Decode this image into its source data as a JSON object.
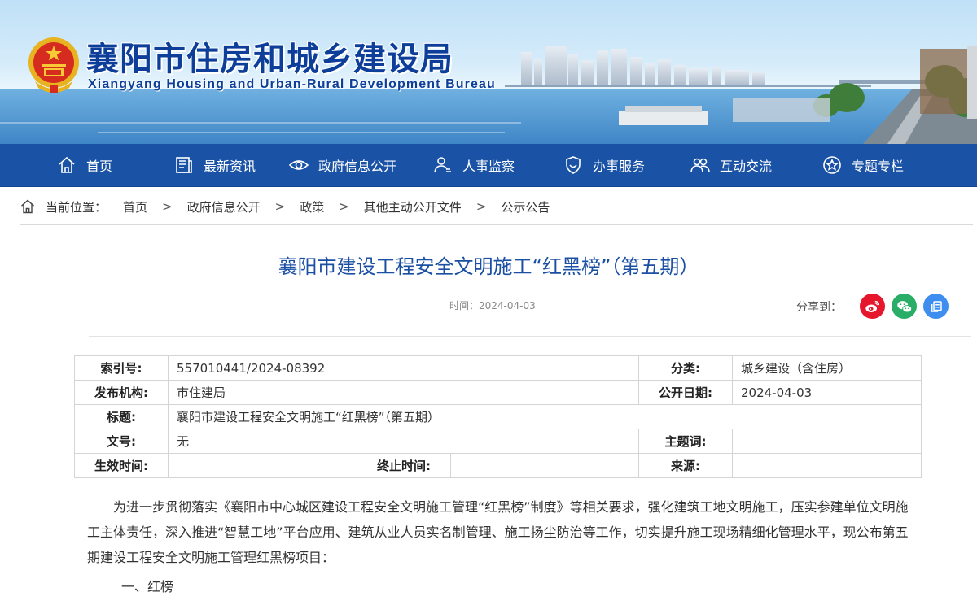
{
  "header": {
    "title": "襄阳市住房和城乡建设局",
    "subtitle": "Xiangyang Housing and Urban-Rural Development Bureau"
  },
  "nav": {
    "items": [
      {
        "label": "首页",
        "icon": "home-icon"
      },
      {
        "label": "最新资讯",
        "icon": "news-icon"
      },
      {
        "label": "政府信息公开",
        "icon": "eye-icon"
      },
      {
        "label": "人事监察",
        "icon": "person-icon"
      },
      {
        "label": "办事服务",
        "icon": "shield-icon"
      },
      {
        "label": "互动交流",
        "icon": "people-icon"
      },
      {
        "label": "专题专栏",
        "icon": "star-icon"
      }
    ]
  },
  "breadcrumb": {
    "prefix": "当前位置：",
    "separator": ">",
    "items": [
      "首页",
      "政府信息公开",
      "政策",
      "其他主动公开文件",
      "公示公告"
    ]
  },
  "article": {
    "title": "襄阳市建设工程安全文明施工“红黑榜”（第五期）",
    "time": "时间：2024-04-03",
    "share_label": "分享到：",
    "share_buttons": [
      {
        "name": "weibo",
        "color": "#e6162d"
      },
      {
        "name": "wechat",
        "color": "#2aae67"
      },
      {
        "name": "copy",
        "color": "#3e8ef0"
      }
    ]
  },
  "info": {
    "index_label": "索引号:",
    "index_value": "557010441/2024-08392",
    "category_label": "分类:",
    "category_value": "城乡建设（含住房）",
    "publisher_label": "发布机构:",
    "publisher_value": "市住建局",
    "date_label": "公开日期:",
    "date_value": "2024-04-03",
    "title_label": "标题:",
    "title_value": "襄阳市建设工程安全文明施工“红黑榜”（第五期）",
    "docno_label": "文号:",
    "docno_value": "无",
    "keywords_label": "主题词:",
    "keywords_value": "",
    "effective_label": "生效时间:",
    "effective_value": "",
    "end_label": "终止时间:",
    "end_value": "",
    "source_label": "来源:",
    "source_value": ""
  },
  "body": {
    "paragraph": "为进一步贯彻落实《襄阳市中心城区建设工程安全文明施工管理“红黑榜”制度》等相关要求，强化建筑工地文明施工，压实参建单位文明施工主体责任，深入推进“智慧工地”平台应用、建筑从业人员实名制管理、施工扬尘防治等工作，切实提升施工现场精细化管理水平，现公布第五期建设工程安全文明施工管理红黑榜项目：",
    "section_1": "一、红榜"
  },
  "colors": {
    "nav_bg": "#1a52a6",
    "title_blue": "#1a4fa3",
    "header_blue": "#0d3f9a"
  }
}
